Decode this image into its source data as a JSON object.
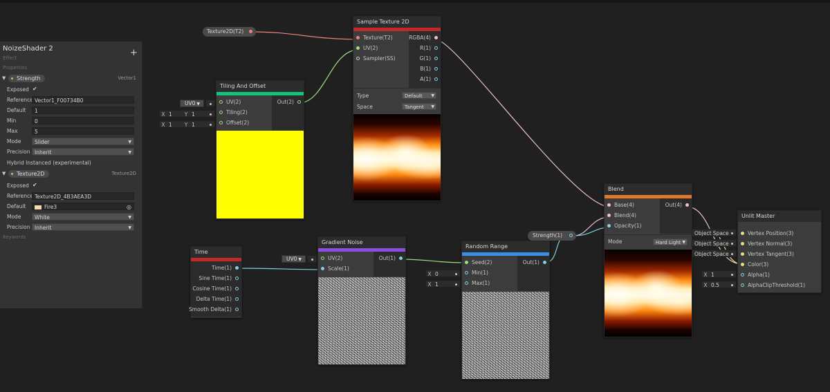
{
  "colors": {
    "texture": "#f07f7f",
    "vec": "#9ddf80",
    "float": "#86d0e2",
    "sampler": "#cccccc",
    "title_tiling": "#14c279",
    "title_sample": "#c62828",
    "title_time": "#c62828",
    "title_gradient": "#8c4de0",
    "title_random": "#3a8ee6",
    "title_blend": "#e07a2a",
    "wire_texture": "#f08080",
    "wire_vec4": "#f0c0d0",
    "wire_vec2": "#9ddf80",
    "wire_float": "#80d0e0",
    "wire_yellow": "#e8e080"
  },
  "blackboard": {
    "title": "NoizeShader 2",
    "subtitle": "Effect",
    "add_icon": "plus-icon",
    "section_label": "Properties",
    "keywords_label": "Keywords",
    "strength": {
      "name": "Strength",
      "type": "Vector1",
      "rows": {
        "exposed_label": "Exposed",
        "exposed_check": "✔",
        "reference_label": "Reference",
        "reference_value": "Vector1_F00734B0",
        "default_label": "Default",
        "default_value": "1",
        "min_label": "Min",
        "min_value": "0",
        "max_label": "Max",
        "max_value": "5",
        "mode_label": "Mode",
        "mode_value": "Slider",
        "precision_label": "Precision",
        "precision_value": "Inherit",
        "hybrid_label": "Hybrid Instanced (experimental)"
      }
    },
    "texture": {
      "name": "Texture2D",
      "type": "Texture2D",
      "rows": {
        "exposed_label": "Exposed",
        "exposed_check": "✔",
        "reference_label": "Reference",
        "reference_value": "Texture2D_4B3AEA3D",
        "default_label": "Default",
        "default_value": "Fire3",
        "mode_label": "Mode",
        "mode_value": "White",
        "precision_label": "Precision",
        "precision_value": "Inherit"
      }
    }
  },
  "property_nodes": {
    "texture": "Texture2D(T2)",
    "strength": "Strength(1)"
  },
  "nodes": {
    "tiling": {
      "title": "Tiling And Offset",
      "inputs": [
        "UV(2)",
        "Tiling(2)",
        "Offset(2)"
      ],
      "outputs": [
        "Out(2)"
      ]
    },
    "sample": {
      "title": "Sample Texture 2D",
      "inputs": [
        "Texture(T2)",
        "UV(2)",
        "Sampler(SS)"
      ],
      "outputs": [
        "RGBA(4)",
        "R(1)",
        "G(1)",
        "B(1)",
        "A(1)"
      ],
      "type_label": "Type",
      "type_value": "Default",
      "space_label": "Space",
      "space_value": "Tangent"
    },
    "time": {
      "title": "Time",
      "outputs": [
        "Time(1)",
        "Sine Time(1)",
        "Cosine Time(1)",
        "Delta Time(1)",
        "Smooth Delta(1)"
      ]
    },
    "gradient": {
      "title": "Gradient Noise",
      "inputs": [
        "UV(2)",
        "Scale(1)"
      ],
      "outputs": [
        "Out(1)"
      ]
    },
    "random": {
      "title": "Random Range",
      "inputs": [
        "Seed(2)",
        "Min(1)",
        "Max(1)"
      ],
      "outputs": [
        "Out(1)"
      ]
    },
    "blend": {
      "title": "Blend",
      "inputs": [
        "Base(4)",
        "Blend(4)",
        "Opacity(1)"
      ],
      "outputs": [
        "Out(4)"
      ],
      "mode_label": "Mode",
      "mode_value": "Hard Light"
    },
    "master": {
      "title": "Unlit Master",
      "inputs": [
        "Vertex Position(3)",
        "Vertex Normal(3)",
        "Vertex Tangent(3)",
        "Color(3)",
        "Alpha(1)",
        "AlphaClipThreshold(1)"
      ]
    }
  },
  "inline_inputs": {
    "uv0_label": "UV0",
    "tiling_x": "1",
    "tiling_y": "1",
    "offset_x": "1",
    "offset_y": "1",
    "random_min": "0",
    "random_max": "1",
    "alpha": "1",
    "alpha_clip": "0.5",
    "object_space": "Object Space",
    "axis_x": "X",
    "axis_y": "Y"
  }
}
